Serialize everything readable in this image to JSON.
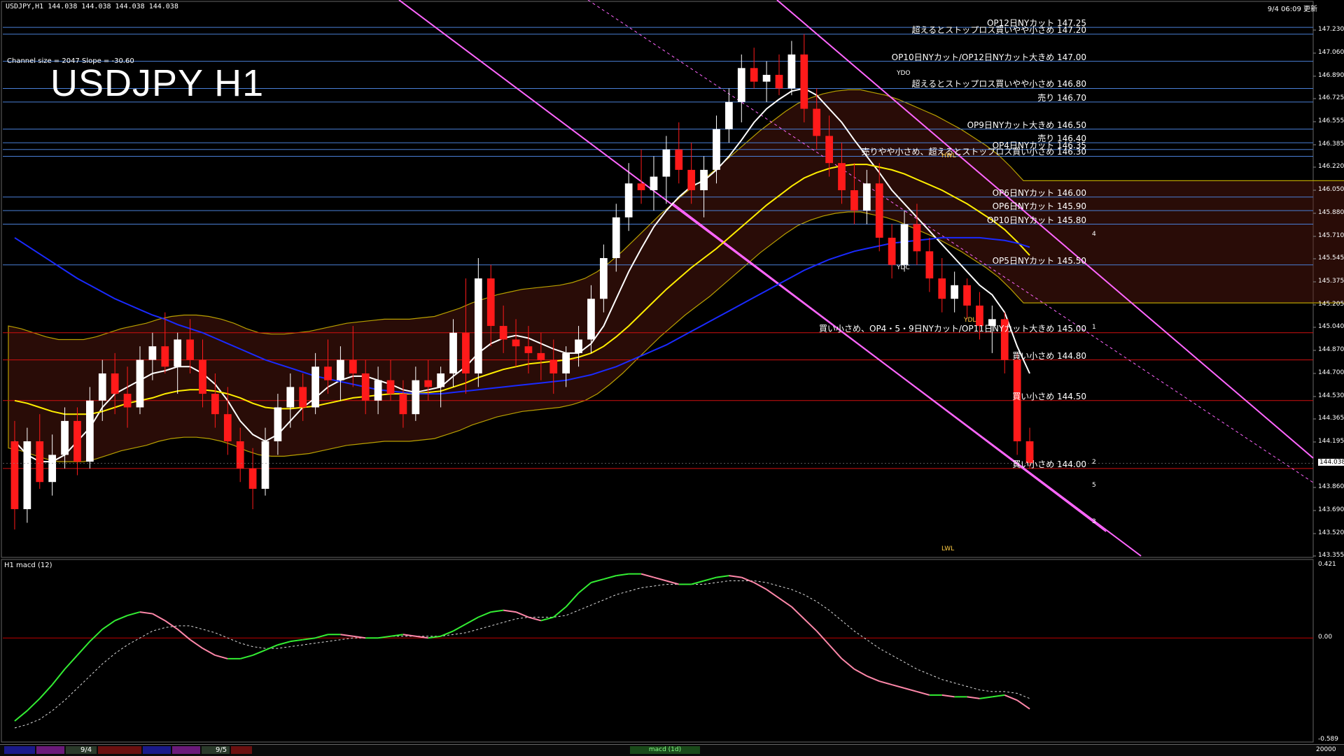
{
  "header": {
    "info": "USDJPY,H1  144.038 144.038 144.038 144.038",
    "top_right": "9/4 06:09 更新",
    "channel": "Channel size = 2047 Slope = -30.60",
    "title": "USDJPY H1"
  },
  "price_axis": {
    "labels": [
      "147.230",
      "147.060",
      "146.890",
      "146.725",
      "146.555",
      "146.385",
      "146.220",
      "146.050",
      "145.880",
      "145.710",
      "145.545",
      "145.375",
      "145.205",
      "145.040",
      "144.870",
      "144.700",
      "144.530",
      "144.365",
      "144.195",
      "143.860",
      "143.690",
      "143.520",
      "143.355"
    ],
    "current": "144.038"
  },
  "levels": [
    {
      "text": "OP12日NYカット 147.25",
      "price": 147.25,
      "color": "#4a7fd6"
    },
    {
      "text": "超えるとストップロス買いやや小さめ 147.20",
      "price": 147.2,
      "color": "#4a7fd6"
    },
    {
      "text": "OP10日NYカット/OP12日NYカット大きめ 147.00",
      "price": 147.0,
      "color": "#4a7fd6"
    },
    {
      "text": "超えるとストップロス買いやや小さめ 146.80",
      "price": 146.8,
      "color": "#4a7fd6"
    },
    {
      "text": "売り 146.70",
      "price": 146.7,
      "color": "#4a7fd6"
    },
    {
      "text": "OP9日NYカット大きめ 146.50",
      "price": 146.5,
      "color": "#4a7fd6"
    },
    {
      "text": "売り 146.40",
      "price": 146.4,
      "color": "#4a7fd6"
    },
    {
      "text": "OP4日NYカット 146.35",
      "price": 146.35,
      "color": "#4a7fd6"
    },
    {
      "text": "売りやや小さめ、超えるとストップロス買い小さめ 146.30",
      "price": 146.3,
      "color": "#4a7fd6"
    },
    {
      "text": "OP6日NYカット 146.00",
      "price": 146.0,
      "color": "#4a7fd6"
    },
    {
      "text": "OP6日NYカット 145.90",
      "price": 145.9,
      "color": "#4a7fd6"
    },
    {
      "text": "OP10日NYカット 145.80",
      "price": 145.8,
      "color": "#4a7fd6"
    },
    {
      "text": "OP5日NYカット 145.50",
      "price": 145.5,
      "color": "#4a7fd6"
    },
    {
      "text": "買い小さめ、OP4・5・9日NYカット/OP11日NYカット大きめ 145.00",
      "price": 145.0,
      "color": "#d01010"
    },
    {
      "text": "買い小さめ 144.80",
      "price": 144.8,
      "color": "#d01010"
    },
    {
      "text": "買い小さめ 144.50",
      "price": 144.5,
      "color": "#d01010"
    },
    {
      "text": "買い小さめ 144.00",
      "price": 144.0,
      "color": "#d01010"
    }
  ],
  "tags": {
    "ydo": "YDO",
    "ydc": "YDC",
    "ydl": "YDL",
    "lwl": "LWL",
    "hwl": "HWL",
    "n1": "1",
    "n2": "2",
    "n3": "3",
    "n4": "4",
    "n5": "5"
  },
  "macd": {
    "label": "H1  macd (12)",
    "axis": [
      "0.421",
      "0.00",
      "-0.589"
    ]
  },
  "bottom": {
    "dates": [
      "9/4",
      "9/5"
    ],
    "status": "macd (1d)",
    "zoom": "20000"
  },
  "colors": {
    "background": "#000000",
    "bull_candle": "#ffffff",
    "bear_candle": "#ff1a1a",
    "ma_fast": "#ffffff",
    "ma_mid": "#ffee00",
    "ma_slow": "#1a2aff",
    "channel": "#ff66ff",
    "macd_up": "#33ee33",
    "macd_down": "#ff88aa"
  },
  "chart_data": {
    "type": "candlestick",
    "symbol": "USDJPY",
    "timeframe": "H1",
    "ylim": [
      143.355,
      147.4
    ],
    "current_price": 144.038,
    "ohlc": [
      [
        144.2,
        144.35,
        143.55,
        143.7
      ],
      [
        143.7,
        144.3,
        143.6,
        144.2
      ],
      [
        144.2,
        144.4,
        143.85,
        143.9
      ],
      [
        143.9,
        144.25,
        143.8,
        144.1
      ],
      [
        144.1,
        144.45,
        144.0,
        144.35
      ],
      [
        144.35,
        144.45,
        143.95,
        144.05
      ],
      [
        144.05,
        144.6,
        144.0,
        144.5
      ],
      [
        144.5,
        144.8,
        144.35,
        144.7
      ],
      [
        144.7,
        144.85,
        144.4,
        144.55
      ],
      [
        144.55,
        144.75,
        144.3,
        144.45
      ],
      [
        144.45,
        144.9,
        144.4,
        144.8
      ],
      [
        144.8,
        145.0,
        144.65,
        144.9
      ],
      [
        144.9,
        145.15,
        144.7,
        144.75
      ],
      [
        144.75,
        145.0,
        144.55,
        144.95
      ],
      [
        144.95,
        145.1,
        144.7,
        144.8
      ],
      [
        144.8,
        144.95,
        144.45,
        144.55
      ],
      [
        144.55,
        144.7,
        144.3,
        144.4
      ],
      [
        144.4,
        144.6,
        144.1,
        144.2
      ],
      [
        144.2,
        144.3,
        143.9,
        144.0
      ],
      [
        144.0,
        144.15,
        143.7,
        143.85
      ],
      [
        143.85,
        144.3,
        143.8,
        144.2
      ],
      [
        144.2,
        144.55,
        144.1,
        144.45
      ],
      [
        144.45,
        144.7,
        144.3,
        144.6
      ],
      [
        144.6,
        144.7,
        144.35,
        144.45
      ],
      [
        144.45,
        144.85,
        144.4,
        144.75
      ],
      [
        144.75,
        144.95,
        144.55,
        144.65
      ],
      [
        144.65,
        144.9,
        144.5,
        144.8
      ],
      [
        144.8,
        145.05,
        144.6,
        144.7
      ],
      [
        144.7,
        144.8,
        144.4,
        144.5
      ],
      [
        144.5,
        144.75,
        144.4,
        144.65
      ],
      [
        144.65,
        144.8,
        144.5,
        144.55
      ],
      [
        144.55,
        144.65,
        144.3,
        144.4
      ],
      [
        144.4,
        144.75,
        144.35,
        144.65
      ],
      [
        144.65,
        144.8,
        144.5,
        144.6
      ],
      [
        144.6,
        144.75,
        144.45,
        144.7
      ],
      [
        144.7,
        145.1,
        144.6,
        145.0
      ],
      [
        145.0,
        145.4,
        144.55,
        144.7
      ],
      [
        144.7,
        145.55,
        144.6,
        145.4
      ],
      [
        145.4,
        145.5,
        144.9,
        145.05
      ],
      [
        145.05,
        145.2,
        144.85,
        144.95
      ],
      [
        144.95,
        145.1,
        144.75,
        144.9
      ],
      [
        144.9,
        145.05,
        144.7,
        144.85
      ],
      [
        144.85,
        145.0,
        144.65,
        144.8
      ],
      [
        144.8,
        144.95,
        144.55,
        144.7
      ],
      [
        144.7,
        144.9,
        144.6,
        144.85
      ],
      [
        144.85,
        145.05,
        144.75,
        144.95
      ],
      [
        144.95,
        145.35,
        144.85,
        145.25
      ],
      [
        145.25,
        145.65,
        145.15,
        145.55
      ],
      [
        145.55,
        145.95,
        145.45,
        145.85
      ],
      [
        145.85,
        146.25,
        145.75,
        146.1
      ],
      [
        146.1,
        146.35,
        145.95,
        146.05
      ],
      [
        146.05,
        146.3,
        145.9,
        146.15
      ],
      [
        146.15,
        146.45,
        145.95,
        146.35
      ],
      [
        146.35,
        146.55,
        146.1,
        146.2
      ],
      [
        146.2,
        146.4,
        145.95,
        146.05
      ],
      [
        146.05,
        146.3,
        145.85,
        146.2
      ],
      [
        146.2,
        146.6,
        146.1,
        146.5
      ],
      [
        146.5,
        146.8,
        146.4,
        146.7
      ],
      [
        146.7,
        147.05,
        146.55,
        146.95
      ],
      [
        146.95,
        147.1,
        146.8,
        146.85
      ],
      [
        146.85,
        147.0,
        146.7,
        146.9
      ],
      [
        146.9,
        147.05,
        146.75,
        146.8
      ],
      [
        146.8,
        147.15,
        146.75,
        147.05
      ],
      [
        147.05,
        147.2,
        146.55,
        146.65
      ],
      [
        146.65,
        146.8,
        146.35,
        146.45
      ],
      [
        146.45,
        146.6,
        146.15,
        146.25
      ],
      [
        146.25,
        146.4,
        145.95,
        146.05
      ],
      [
        146.05,
        146.25,
        145.8,
        145.9
      ],
      [
        145.9,
        146.2,
        145.8,
        146.1
      ],
      [
        146.1,
        146.25,
        145.6,
        145.7
      ],
      [
        145.7,
        145.8,
        145.4,
        145.5
      ],
      [
        145.5,
        145.9,
        145.45,
        145.8
      ],
      [
        145.8,
        145.95,
        145.5,
        145.6
      ],
      [
        145.6,
        145.7,
        145.3,
        145.4
      ],
      [
        145.4,
        145.55,
        145.15,
        145.25
      ],
      [
        145.25,
        145.45,
        145.15,
        145.35
      ],
      [
        145.35,
        145.4,
        145.1,
        145.2
      ],
      [
        145.2,
        145.3,
        144.95,
        145.05
      ],
      [
        145.05,
        145.2,
        144.85,
        145.1
      ],
      [
        145.1,
        145.15,
        144.7,
        144.8
      ],
      [
        144.8,
        144.85,
        144.1,
        144.2
      ],
      [
        144.2,
        144.3,
        144.0,
        144.04
      ]
    ],
    "series": [
      {
        "values": [
          144.2,
          144.1,
          144.05,
          144.05,
          144.1,
          144.2,
          144.3,
          144.45,
          144.55,
          144.6,
          144.65,
          144.7,
          144.72,
          144.75,
          144.75,
          144.7,
          144.62,
          144.5,
          144.35,
          144.25,
          144.2,
          144.25,
          144.35,
          144.45,
          144.52,
          144.6,
          144.65,
          144.68,
          144.68,
          144.65,
          144.62,
          144.58,
          144.56,
          144.58,
          144.6,
          144.68,
          144.75,
          144.85,
          144.92,
          144.96,
          144.98,
          144.96,
          144.92,
          144.88,
          144.85,
          144.85,
          144.92,
          145.05,
          145.25,
          145.45,
          145.62,
          145.78,
          145.9,
          146.0,
          146.08,
          146.12,
          146.2,
          146.3,
          146.42,
          146.55,
          146.65,
          146.72,
          146.78,
          146.8,
          146.75,
          146.65,
          146.55,
          146.42,
          146.3,
          146.18,
          146.05,
          145.95,
          145.85,
          145.75,
          145.65,
          145.55,
          145.45,
          145.35,
          145.28,
          145.15,
          144.9,
          144.7
        ]
      },
      {
        "values": [
          144.5,
          144.48,
          144.45,
          144.42,
          144.4,
          144.4,
          144.4,
          144.42,
          144.45,
          144.48,
          144.5,
          144.52,
          144.55,
          144.57,
          144.58,
          144.58,
          144.57,
          144.55,
          144.52,
          144.48,
          144.45,
          144.44,
          144.44,
          144.45,
          144.46,
          144.48,
          144.5,
          144.52,
          144.53,
          144.54,
          144.55,
          144.55,
          144.55,
          144.56,
          144.57,
          144.6,
          144.63,
          144.67,
          144.7,
          144.73,
          144.75,
          144.77,
          144.78,
          144.79,
          144.8,
          144.82,
          144.85,
          144.9,
          144.97,
          145.05,
          145.14,
          145.23,
          145.32,
          145.4,
          145.48,
          145.55,
          145.62,
          145.7,
          145.78,
          145.86,
          145.94,
          146.01,
          146.08,
          146.14,
          146.18,
          146.21,
          146.23,
          146.24,
          146.24,
          146.22,
          146.2,
          146.17,
          146.13,
          146.09,
          146.05,
          146.0,
          145.95,
          145.89,
          145.83,
          145.76,
          145.67,
          145.57
        ]
      },
      {
        "values": [
          145.7,
          145.64,
          145.58,
          145.52,
          145.46,
          145.4,
          145.35,
          145.3,
          145.25,
          145.21,
          145.17,
          145.13,
          145.1,
          145.06,
          145.03,
          145.0,
          144.96,
          144.92,
          144.88,
          144.84,
          144.8,
          144.77,
          144.74,
          144.71,
          144.68,
          144.66,
          144.64,
          144.62,
          144.6,
          144.58,
          144.57,
          144.56,
          144.55,
          144.55,
          144.55,
          144.56,
          144.57,
          144.58,
          144.59,
          144.6,
          144.61,
          144.62,
          144.63,
          144.64,
          144.65,
          144.67,
          144.69,
          144.72,
          144.75,
          144.79,
          144.83,
          144.87,
          144.91,
          144.96,
          145.01,
          145.06,
          145.11,
          145.16,
          145.21,
          145.26,
          145.31,
          145.36,
          145.41,
          145.46,
          145.5,
          145.54,
          145.57,
          145.6,
          145.62,
          145.64,
          145.66,
          145.67,
          145.68,
          145.69,
          145.7,
          145.7,
          145.7,
          145.7,
          145.69,
          145.68,
          145.66,
          145.63
        ]
      }
    ],
    "macd": {
      "ylim": [
        -0.589,
        0.421
      ],
      "main": [
        -0.48,
        -0.42,
        -0.35,
        -0.27,
        -0.18,
        -0.1,
        -0.02,
        0.05,
        0.1,
        0.13,
        0.15,
        0.14,
        0.1,
        0.05,
        -0.01,
        -0.06,
        -0.1,
        -0.12,
        -0.12,
        -0.1,
        -0.07,
        -0.04,
        -0.02,
        -0.01,
        0.0,
        0.02,
        0.02,
        0.01,
        0.0,
        0.0,
        0.01,
        0.02,
        0.01,
        0.0,
        0.01,
        0.04,
        0.08,
        0.12,
        0.15,
        0.16,
        0.15,
        0.12,
        0.1,
        0.12,
        0.18,
        0.26,
        0.32,
        0.34,
        0.36,
        0.37,
        0.37,
        0.35,
        0.33,
        0.31,
        0.31,
        0.33,
        0.35,
        0.36,
        0.35,
        0.32,
        0.28,
        0.23,
        0.18,
        0.11,
        0.04,
        -0.04,
        -0.12,
        -0.18,
        -0.22,
        -0.25,
        -0.27,
        -0.29,
        -0.31,
        -0.33,
        -0.33,
        -0.34,
        -0.34,
        -0.35,
        -0.34,
        -0.33,
        -0.36,
        -0.41
      ],
      "signal": [
        -0.52,
        -0.5,
        -0.47,
        -0.42,
        -0.36,
        -0.29,
        -0.22,
        -0.15,
        -0.09,
        -0.04,
        0.0,
        0.04,
        0.06,
        0.07,
        0.07,
        0.05,
        0.03,
        0.0,
        -0.03,
        -0.05,
        -0.06,
        -0.06,
        -0.05,
        -0.04,
        -0.03,
        -0.02,
        -0.01,
        0.0,
        0.0,
        0.0,
        0.01,
        0.01,
        0.01,
        0.01,
        0.01,
        0.02,
        0.03,
        0.05,
        0.07,
        0.09,
        0.11,
        0.12,
        0.12,
        0.12,
        0.13,
        0.16,
        0.19,
        0.22,
        0.25,
        0.27,
        0.29,
        0.3,
        0.31,
        0.31,
        0.31,
        0.31,
        0.32,
        0.33,
        0.33,
        0.33,
        0.32,
        0.3,
        0.28,
        0.25,
        0.21,
        0.16,
        0.1,
        0.04,
        -0.01,
        -0.06,
        -0.1,
        -0.14,
        -0.18,
        -0.21,
        -0.24,
        -0.26,
        -0.28,
        -0.3,
        -0.31,
        -0.31,
        -0.32,
        -0.35
      ]
    }
  }
}
